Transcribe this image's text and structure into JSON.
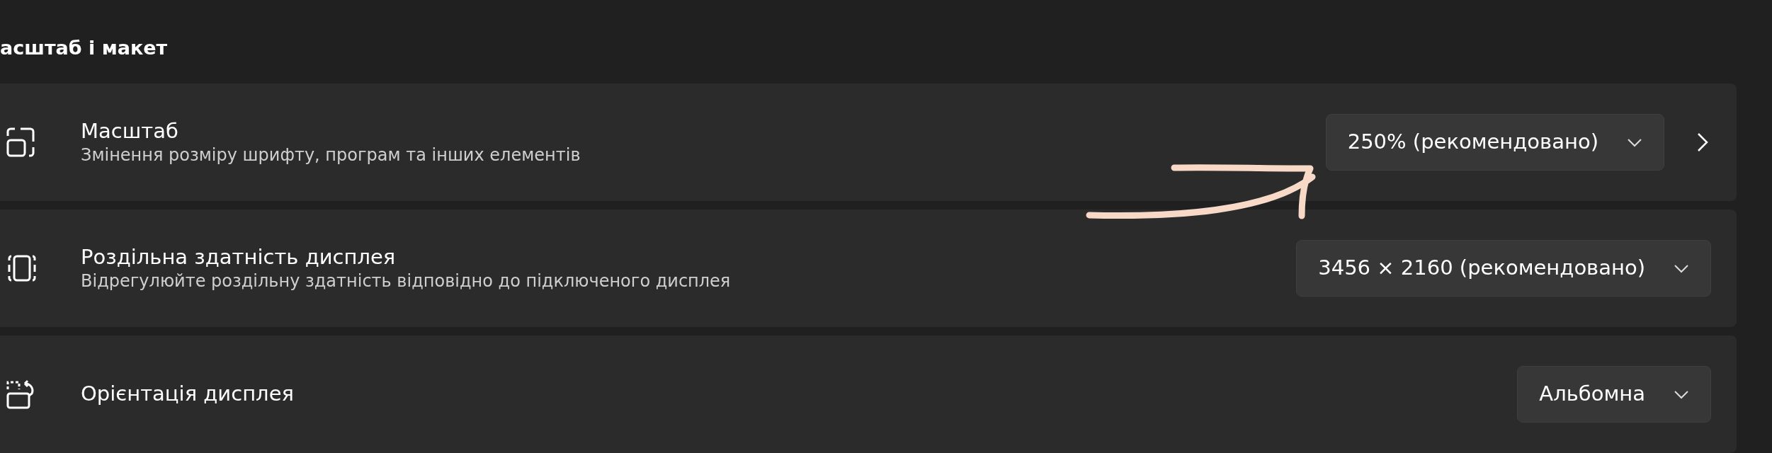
{
  "section": {
    "title": "асштаб і макет"
  },
  "settings": [
    {
      "kind": "scale",
      "title": "Масштаб",
      "subtitle": "Змінення розміру шрифту, програм та інших елементів",
      "value": "250% (рекомендовано)",
      "has_chevron": true
    },
    {
      "kind": "resolution",
      "title": "Роздільна здатність дисплея",
      "subtitle": "Відрегулюйте роздільну здатність відповідно до  підключеного дисплея",
      "value": "3456 × 2160 (рекомендовано)",
      "has_chevron": false
    },
    {
      "kind": "orientation",
      "title": "Орієнтація дисплея",
      "value": "Альбомна",
      "has_chevron": false
    }
  ]
}
